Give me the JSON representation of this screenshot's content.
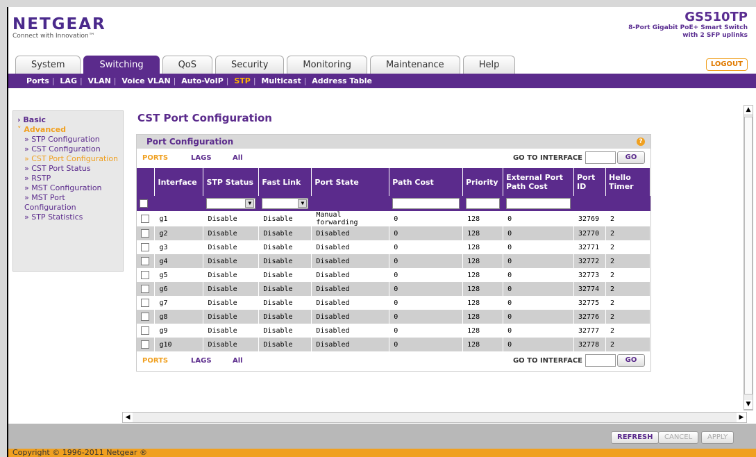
{
  "header": {
    "brand": "NETGEAR",
    "tagline": "Connect with Innovation™",
    "model": "GS510TP",
    "model_desc_1": "8-Port Gigabit PoE+ Smart Switch",
    "model_desc_2": "with 2 SFP uplinks",
    "logout": "LOGOUT"
  },
  "tabs": [
    {
      "label": "System"
    },
    {
      "label": "Switching"
    },
    {
      "label": "QoS"
    },
    {
      "label": "Security"
    },
    {
      "label": "Monitoring"
    },
    {
      "label": "Maintenance"
    },
    {
      "label": "Help"
    }
  ],
  "subnav": [
    "Ports",
    "LAG",
    "VLAN",
    "Voice VLAN",
    "Auto-VoIP",
    "STP",
    "Multicast",
    "Address Table"
  ],
  "leftnav": {
    "basic": "Basic",
    "advanced": "Advanced",
    "items": [
      "STP Configuration",
      "CST Configuration",
      "CST Port Configuration",
      "CST Port Status",
      "RSTP",
      "MST Configuration",
      "MST Port Configuration",
      "STP Statistics"
    ]
  },
  "page": {
    "title": "CST Port Configuration",
    "panel_title": "Port Configuration",
    "filter_ports": "PORTS",
    "filter_lags": "LAGS",
    "filter_all": "All",
    "goto_label": "GO TO INTERFACE",
    "go": "GO"
  },
  "table": {
    "headers": [
      "Interface",
      "STP Status",
      "Fast Link",
      "Port State",
      "Path Cost",
      "Priority",
      "External Port Path Cost",
      "Port ID",
      "Hello Timer"
    ],
    "rows": [
      [
        "g1",
        "Disable",
        "Disable",
        "Manual forwarding",
        "0",
        "128",
        "0",
        "32769",
        "2"
      ],
      [
        "g2",
        "Disable",
        "Disable",
        "Disabled",
        "0",
        "128",
        "0",
        "32770",
        "2"
      ],
      [
        "g3",
        "Disable",
        "Disable",
        "Disabled",
        "0",
        "128",
        "0",
        "32771",
        "2"
      ],
      [
        "g4",
        "Disable",
        "Disable",
        "Disabled",
        "0",
        "128",
        "0",
        "32772",
        "2"
      ],
      [
        "g5",
        "Disable",
        "Disable",
        "Disabled",
        "0",
        "128",
        "0",
        "32773",
        "2"
      ],
      [
        "g6",
        "Disable",
        "Disable",
        "Disabled",
        "0",
        "128",
        "0",
        "32774",
        "2"
      ],
      [
        "g7",
        "Disable",
        "Disable",
        "Disabled",
        "0",
        "128",
        "0",
        "32775",
        "2"
      ],
      [
        "g8",
        "Disable",
        "Disable",
        "Disabled",
        "0",
        "128",
        "0",
        "32776",
        "2"
      ],
      [
        "g9",
        "Disable",
        "Disable",
        "Disabled",
        "0",
        "128",
        "0",
        "32777",
        "2"
      ],
      [
        "g10",
        "Disable",
        "Disable",
        "Disabled",
        "0",
        "128",
        "0",
        "32778",
        "2"
      ]
    ]
  },
  "footer": {
    "refresh": "REFRESH",
    "cancel": "CANCEL",
    "apply": "APPLY",
    "copyright": "Copyright © 1996-2011 Netgear ®"
  },
  "colors": {
    "brand_purple": "#5b2b8c",
    "accent_orange": "#f0a020"
  }
}
